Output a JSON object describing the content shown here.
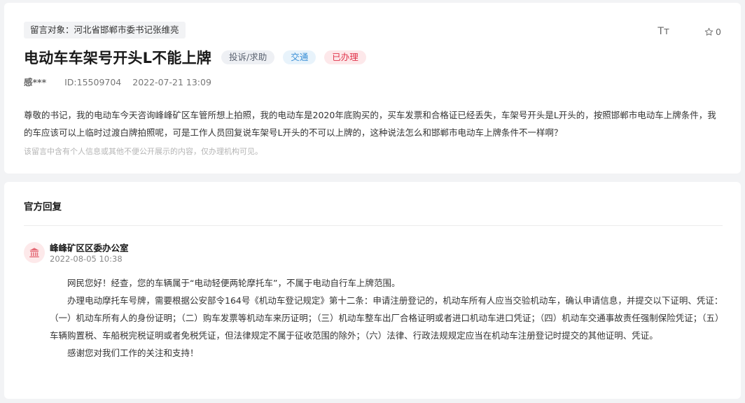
{
  "message": {
    "target": "留言对象：河北省邯郸市委书记张维亮",
    "title": "电动车车架号开头L不能上牌",
    "tags": {
      "category": "投诉/求助",
      "field": "交通",
      "status": "已办理"
    },
    "toolbar": {
      "font_label": "Tт",
      "star_count": "0"
    },
    "author": "感***",
    "id": "ID:15509704",
    "time": "2022-07-21 13:09",
    "content": "尊敬的书记，我的电动车今天咨询峰峰矿区车管所想上拍照，我的电动车是2020年底购买的，买车发票和合格证已经丢失，车架号开头是L开头的，按照邯郸市电动车上牌条件，我的车应该可以上临时过渡白牌拍照呢，可是工作人员回复说车架号L开头的不可以上牌的，这种说法怎么和邯郸市电动车上牌条件不一样啊？",
    "notice": "该留言中含有个人信息或其他不便公开展示的内容，仅办理机构可见。"
  },
  "reply": {
    "section_title": "官方回复",
    "org_name": "峰峰矿区区委办公室",
    "time": "2022-08-05 10:38",
    "paragraphs": [
      "网民您好！经查，您的车辆属于“电动轻便两轮摩托车”，不属于电动自行车上牌范围。",
      "办理电动摩托车号牌，需要根据公安部令164号《机动车登记规定》第十二条：申请注册登记的，机动车所有人应当交验机动车，确认申请信息，并提交以下证明、凭证：（一）机动车所有人的身份证明；（二）购车发票等机动车来历证明；（三）机动车整车出厂合格证明或者进口机动车进口凭证；（四）机动车交通事故责任强制保险凭证；（五）车辆购置税、车船税完税证明或者免税凭证，但法律规定不属于征收范围的除外；（六）法律、行政法规规定应当在机动车注册登记时提交的其他证明、凭证。",
      "感谢您对我们工作的关注和支持！"
    ]
  }
}
